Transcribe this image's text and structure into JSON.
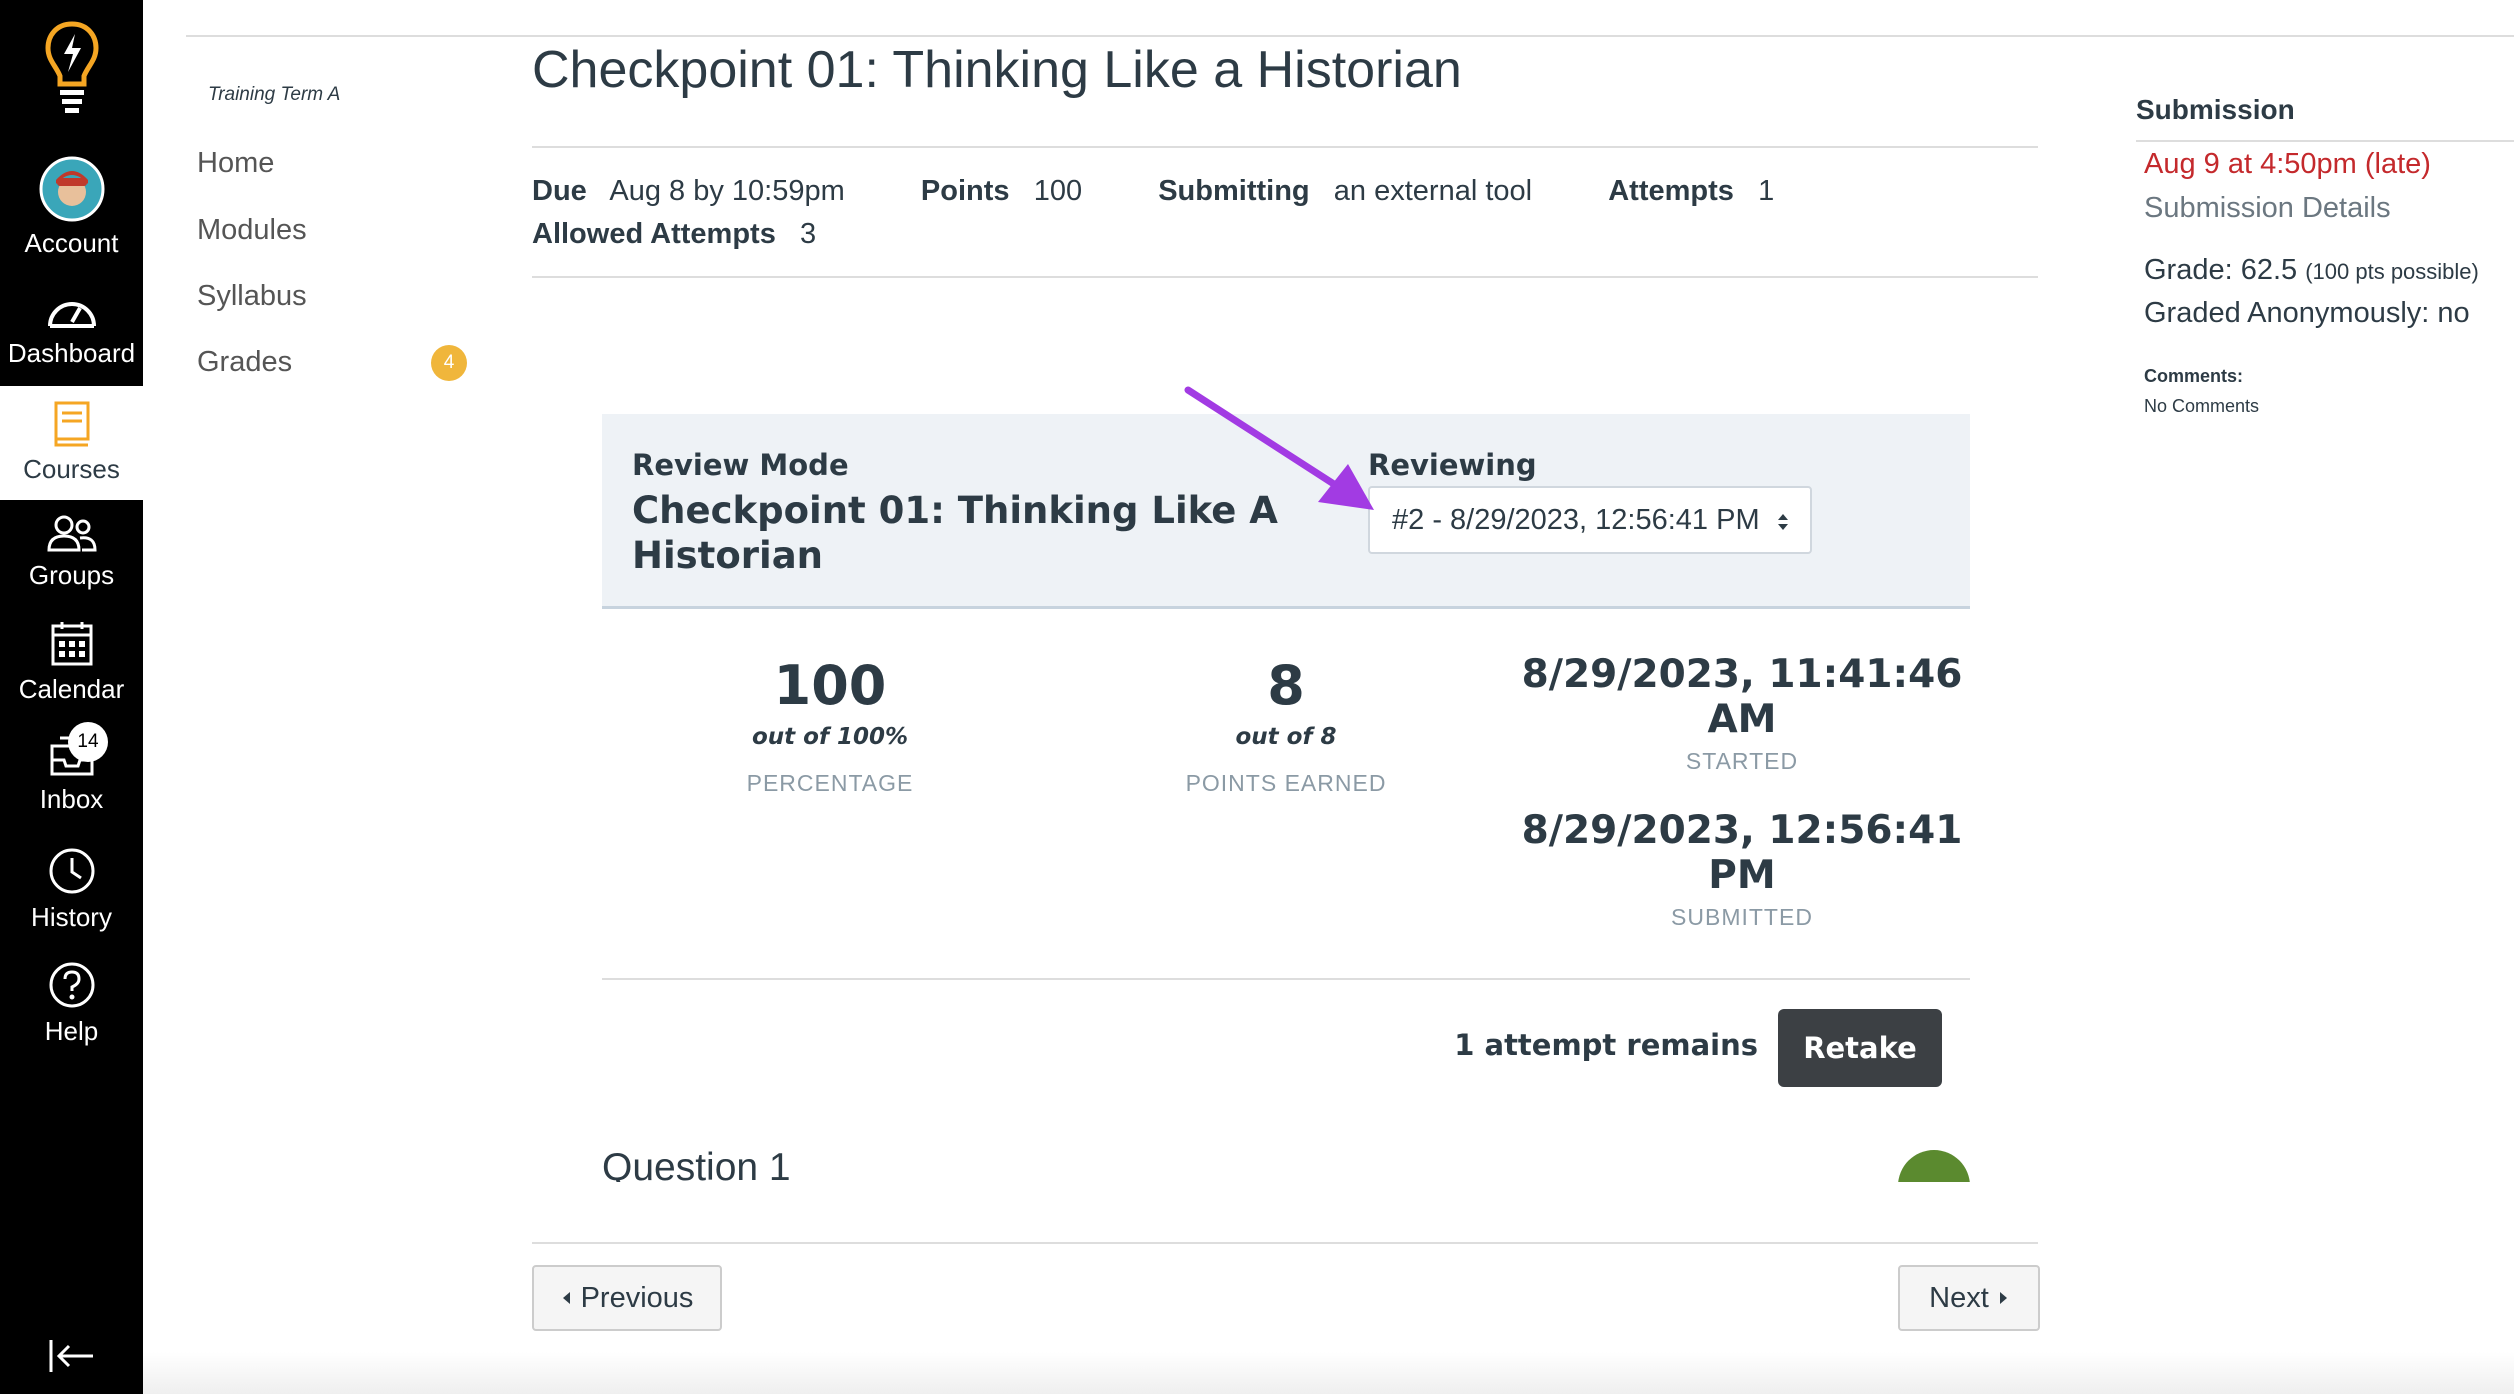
{
  "global_nav": {
    "account": "Account",
    "dashboard": "Dashboard",
    "courses": "Courses",
    "groups": "Groups",
    "calendar": "Calendar",
    "inbox": "Inbox",
    "inbox_badge": "14",
    "history": "History",
    "help": "Help"
  },
  "course_nav": {
    "term": "Training Term A",
    "items": [
      "Home",
      "Modules",
      "Syllabus",
      "Grades"
    ],
    "grades_badge": "4"
  },
  "assignment": {
    "title": "Checkpoint 01: Thinking Like a Historian",
    "due_label": "Due",
    "due_value": "Aug 8 by 10:59pm",
    "points_label": "Points",
    "points_value": "100",
    "submitting_label": "Submitting",
    "submitting_value": "an external tool",
    "attempts_label": "Attempts",
    "attempts_value": "1",
    "allowed_label": "Allowed Attempts",
    "allowed_value": "3"
  },
  "review": {
    "mode_label": "Review Mode",
    "quiz_title_line1": "Checkpoint 01: Thinking Like A",
    "quiz_title_line2": "Historian",
    "reviewing_label": "Reviewing",
    "selected_attempt": "#2 - 8/29/2023, 12:56:41 PM"
  },
  "stats": {
    "percentage_value": "100",
    "percentage_sub": "out of 100%",
    "percentage_caption": "PERCENTAGE",
    "points_value": "8",
    "points_sub": "out of 8",
    "points_caption": "POINTS EARNED",
    "started_line1": "8/29/2023, 11:41:46",
    "started_line2": "AM",
    "started_caption": "STARTED",
    "submitted_line1": "8/29/2023, 12:56:41",
    "submitted_line2": "PM",
    "submitted_caption": "SUBMITTED"
  },
  "attempts": {
    "remaining": "1 attempt remains",
    "retake_label": "Retake"
  },
  "question": {
    "label": "Question 1"
  },
  "pager": {
    "previous": "Previous",
    "next": "Next"
  },
  "sidebar": {
    "heading": "Submission",
    "submitted_at": "Aug 9 at 4:50pm (late)",
    "details_link": "Submission Details",
    "grade_label": "Grade: 62.5",
    "grade_possible": "(100 pts possible)",
    "anonymous": "Graded Anonymously: no",
    "comments_label": "Comments:",
    "comments_value": "No Comments"
  },
  "colors": {
    "nav_bg": "#000000",
    "late_red": "#c4292c",
    "badge_orange": "#f0b63b",
    "arrow_purple": "#a23be3",
    "retake_bg": "#3c4044",
    "question_points_green": "#5b8a2f"
  }
}
